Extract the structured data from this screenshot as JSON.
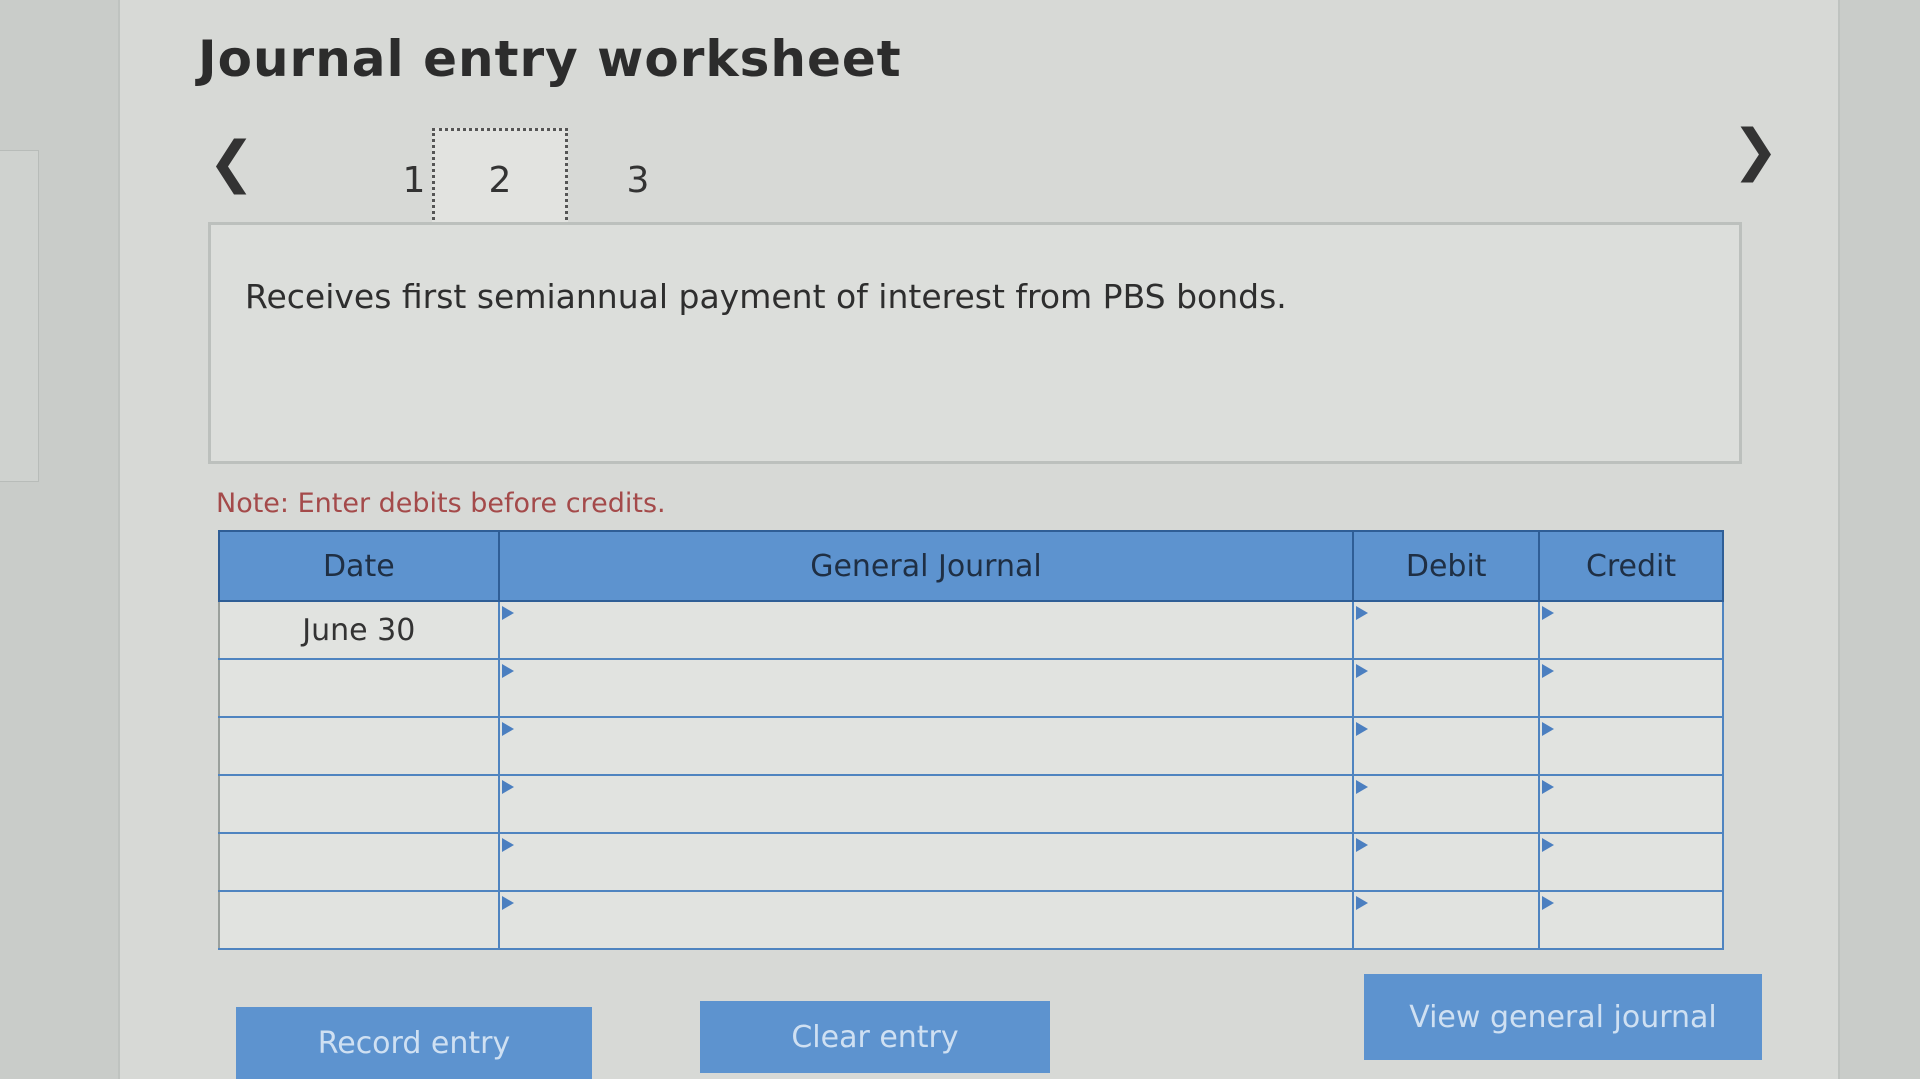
{
  "header": {
    "title": "Journal entry worksheet"
  },
  "nav": {
    "prev_icon": "chevron-left-icon",
    "next_icon": "chevron-right-icon",
    "tabs": [
      {
        "label": "1",
        "active": false
      },
      {
        "label": "2",
        "active": true
      },
      {
        "label": "3",
        "active": false
      }
    ]
  },
  "description": {
    "text": "Receives first semiannual payment of interest from PBS bonds."
  },
  "note": {
    "text": "Note: Enter debits before credits."
  },
  "journal": {
    "headers": {
      "date": "Date",
      "general_journal": "General Journal",
      "debit": "Debit",
      "credit": "Credit"
    },
    "rows": [
      {
        "date": "June 30",
        "account": "",
        "debit": "",
        "credit": ""
      },
      {
        "date": "",
        "account": "",
        "debit": "",
        "credit": ""
      },
      {
        "date": "",
        "account": "",
        "debit": "",
        "credit": ""
      },
      {
        "date": "",
        "account": "",
        "debit": "",
        "credit": ""
      },
      {
        "date": "",
        "account": "",
        "debit": "",
        "credit": ""
      },
      {
        "date": "",
        "account": "",
        "debit": "",
        "credit": ""
      }
    ]
  },
  "buttons": {
    "record": "Record entry",
    "clear": "Clear entry",
    "view": "View general journal"
  },
  "colors": {
    "accent": "#5d93cf",
    "note": "#a44a4a"
  }
}
